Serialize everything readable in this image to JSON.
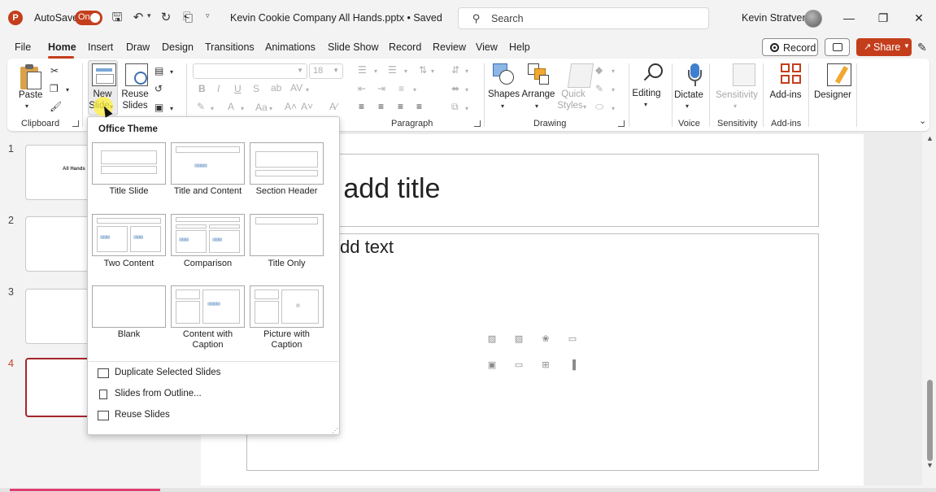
{
  "titlebar": {
    "app_letter": "P",
    "autosave_label": "AutoSave",
    "autosave_state": "On",
    "doc_title": "Kevin Cookie Company All Hands.pptx • Saved",
    "search_placeholder": "Search",
    "user_name": "Kevin Stratvert"
  },
  "tabs": [
    "File",
    "Home",
    "Insert",
    "Draw",
    "Design",
    "Transitions",
    "Animations",
    "Slide Show",
    "Record",
    "Review",
    "View",
    "Help"
  ],
  "active_tab": "Home",
  "actions": {
    "record_label": "Record",
    "share_label": "Share"
  },
  "ribbon": {
    "clipboard": {
      "paste_label": "Paste",
      "group_label": "Clipboard"
    },
    "slides": {
      "new_slide_line1": "New",
      "new_slide_line2": "Slide",
      "reuse_line1": "Reuse",
      "reuse_line2": "Slides"
    },
    "font": {
      "size_value": "18"
    },
    "paragraph": {
      "group_label": "Paragraph"
    },
    "drawing": {
      "shapes_label": "Shapes",
      "arrange_label": "Arrange",
      "quick_styles_line1": "Quick",
      "quick_styles_line2": "Styles",
      "group_label": "Drawing"
    },
    "editing": {
      "label": "Editing"
    },
    "voice": {
      "dictate_label": "Dictate",
      "group_label": "Voice"
    },
    "sensitivity": {
      "label": "Sensitivity",
      "group_label": "Sensitivity"
    },
    "addins": {
      "label": "Add-ins",
      "group_label": "Add-ins"
    },
    "designer": {
      "label": "Designer"
    }
  },
  "thumbnails": [
    {
      "number": "1",
      "text": "All Hands"
    },
    {
      "number": "2",
      "text": ""
    },
    {
      "number": "3",
      "text": ""
    },
    {
      "number": "4",
      "text": ""
    }
  ],
  "slide": {
    "title_placeholder": "o add title",
    "content_placeholder": "dd text"
  },
  "gallery": {
    "heading": "Office Theme",
    "layouts": [
      "Title Slide",
      "Title and Content",
      "Section Header",
      "Two Content",
      "Comparison",
      "Title Only",
      "Blank",
      "Content with Caption",
      "Picture with Caption"
    ],
    "menu_items": [
      "Duplicate Selected Slides",
      "Slides from Outline...",
      "Reuse Slides"
    ]
  },
  "colors": {
    "accent": "#c43e1c",
    "selected_thumb": "#a4262c"
  }
}
